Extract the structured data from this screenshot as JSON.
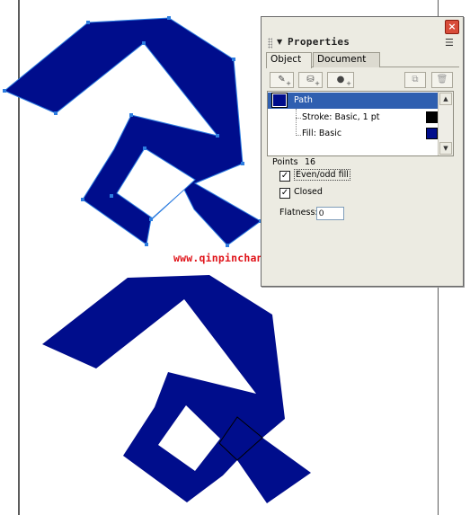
{
  "canvas": {
    "fill_color": "#000d8c",
    "selection_color": "#2d7de0",
    "watermark": "www.qinpinchang.com"
  },
  "panel": {
    "title": "Properties",
    "close_icon": "close-icon",
    "options_icon": "options-menu-icon",
    "tabs": [
      {
        "label": "Object",
        "active": true
      },
      {
        "label": "Document",
        "active": false
      }
    ],
    "toolbar": {
      "buttons": [
        "add-stroke-pencil-icon",
        "add-fill-bucket-icon",
        "add-effect-icon",
        "duplicate-attribute-icon",
        "delete-attribute-icon"
      ]
    },
    "attributes": {
      "path": {
        "label": "Path",
        "color": "#000d8c"
      },
      "stroke": {
        "label": "Stroke: Basic, 1 pt",
        "color": "#000000"
      },
      "fill": {
        "label": "Fill: Basic",
        "color": "#000d8c"
      }
    },
    "points": {
      "label": "Points",
      "value": "16"
    },
    "even_odd": {
      "label": "Even/odd fill",
      "checked": true
    },
    "closed": {
      "label": "Closed",
      "checked": true
    },
    "flatness": {
      "label": "Flatness:",
      "value": "0"
    }
  }
}
